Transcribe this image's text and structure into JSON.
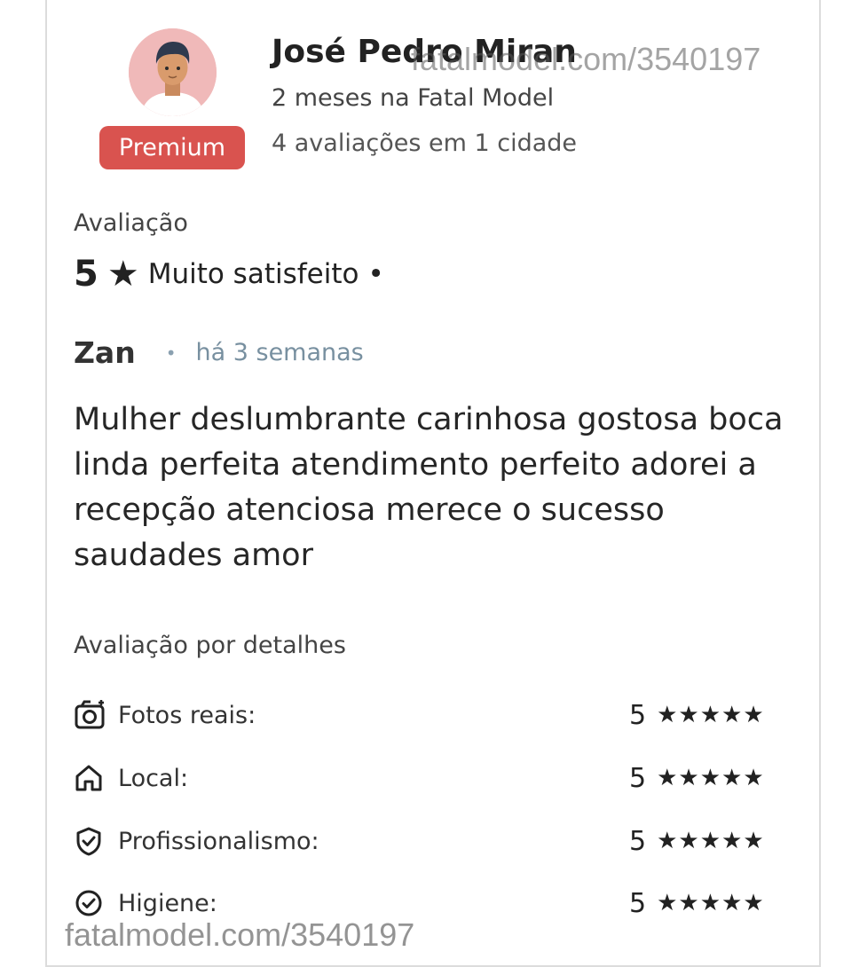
{
  "profile": {
    "name": "José Pedro Miran",
    "badge": "Premium",
    "tenure": "2 meses na Fatal Model",
    "reviews_summary": "4 avaliações em 1 cidade"
  },
  "watermark": {
    "top": "fatalmodel.com/3540197",
    "bottom": "fatalmodel.com/3540197"
  },
  "rating": {
    "label": "Avaliação",
    "score": "5",
    "star": "★",
    "text": "Muito satisfeito",
    "dot": "•"
  },
  "review": {
    "author": "Zan",
    "separator": "•",
    "time": "há 3 semanas",
    "body": "Mulher deslumbrante carinhosa gostosa boca linda perfeita atendimento perfeito adorei a recepção atenciosa merece o sucesso saudades amor"
  },
  "details": {
    "label": "Avaliação por detalhes",
    "items": [
      {
        "label": "Fotos reais:",
        "score": "5",
        "stars": "★★★★★",
        "icon": "camera-icon"
      },
      {
        "label": "Local:",
        "score": "5",
        "stars": "★★★★★",
        "icon": "home-icon"
      },
      {
        "label": "Profissionalismo:",
        "score": "5",
        "stars": "★★★★★",
        "icon": "shield-check-icon"
      },
      {
        "label": "Higiene:",
        "score": "5",
        "stars": "★★★★★",
        "icon": "check-circle-icon"
      }
    ]
  },
  "colors": {
    "badge": "#d9534f",
    "avatar_bg": "#f0b9b9",
    "time_text": "#7890a0"
  }
}
